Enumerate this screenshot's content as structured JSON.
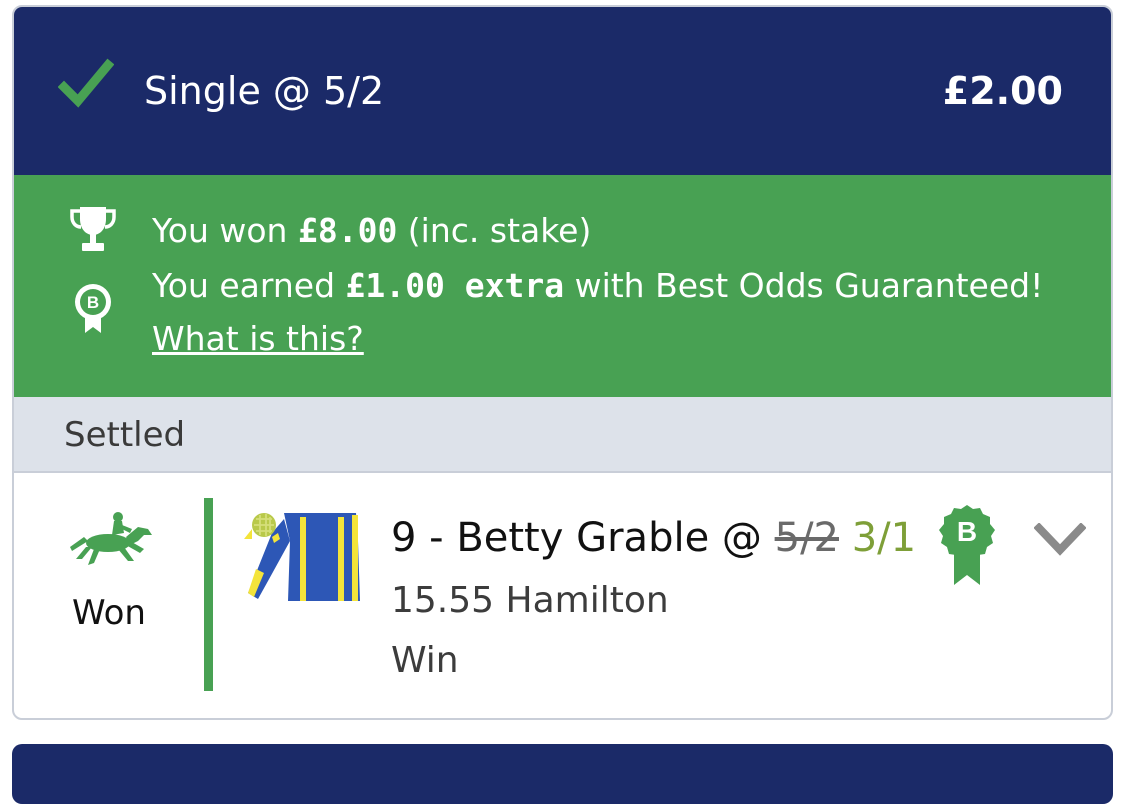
{
  "bet": {
    "type_label": "Single @ 5/2",
    "stake": "£2.00"
  },
  "banner": {
    "won_prefix": "You won ",
    "won_amount": "£8.00",
    "won_suffix": " (inc. stake)",
    "earned_prefix": "You earned ",
    "earned_amount": "£1.00 extra",
    "earned_suffix": " with Best Odds Guaranteed!",
    "help_link": "What is this?",
    "badge_letter": "B"
  },
  "status": {
    "label": "Settled"
  },
  "selection": {
    "result": "Won",
    "name": "9 - Betty Grable @ ",
    "old_price": "5/2",
    "new_price": "3/1",
    "race": "15.55 Hamilton",
    "market": "Win",
    "badge_letter": "B"
  },
  "colors": {
    "header_bg": "#1b2a68",
    "win_green": "#48a153",
    "status_bg": "#dde2ea",
    "boosted_price": "#7e9f38"
  },
  "icons": [
    "check-icon",
    "trophy-icon",
    "best-odds-badge-icon",
    "racehorse-icon",
    "jockey-silks-icon",
    "chevron-down-icon"
  ]
}
